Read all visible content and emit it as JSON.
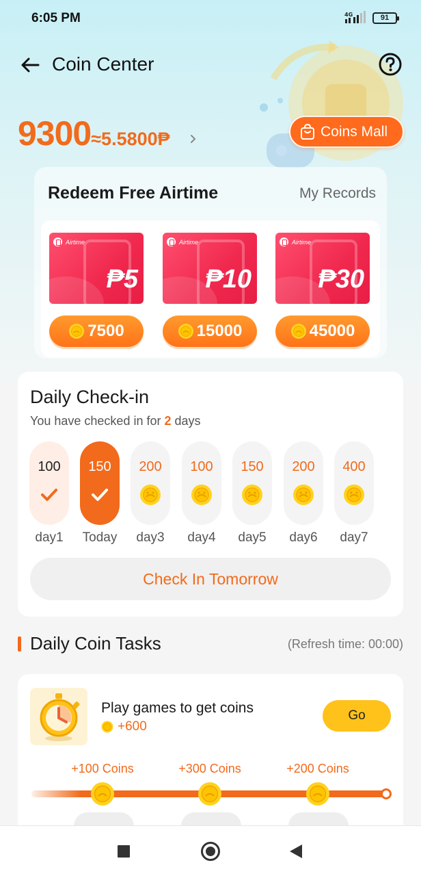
{
  "status_bar": {
    "time": "6:05 PM",
    "network": "4G",
    "battery": "91"
  },
  "header": {
    "title": "Coin Center"
  },
  "balance": {
    "coins": "9300",
    "equivalent": "≈5.5800₱"
  },
  "coins_mall": {
    "label": "Coins Mall"
  },
  "redeem": {
    "title": "Redeem Free Airtime",
    "records_label": "My Records",
    "items": [
      {
        "tag": "Airtime",
        "amount": "₱5",
        "price": "7500"
      },
      {
        "tag": "Airtime",
        "amount": "₱10",
        "price": "15000"
      },
      {
        "tag": "Airtime",
        "amount": "₱30",
        "price": "45000"
      }
    ]
  },
  "checkin": {
    "title": "Daily Check-in",
    "subtitle_prefix": "You have checked in for ",
    "days_count": "2",
    "subtitle_suffix": " days",
    "days": [
      {
        "value": "100",
        "label": "day1",
        "state": "done"
      },
      {
        "value": "150",
        "label": "Today",
        "state": "today"
      },
      {
        "value": "200",
        "label": "day3",
        "state": "pending"
      },
      {
        "value": "100",
        "label": "day4",
        "state": "pending"
      },
      {
        "value": "150",
        "label": "day5",
        "state": "pending"
      },
      {
        "value": "200",
        "label": "day6",
        "state": "pending"
      },
      {
        "value": "400",
        "label": "day7",
        "state": "pending"
      }
    ],
    "button_label": "Check In Tomorrow"
  },
  "tasks": {
    "title": "Daily Coin Tasks",
    "refresh": "(Refresh time: 00:00)",
    "task": {
      "name": "Play games to get coins",
      "reward": "+600",
      "button": "Go",
      "milestones": [
        {
          "label": "+100 Coins"
        },
        {
          "label": "+300 Coins"
        },
        {
          "label": "+200 Coins"
        }
      ]
    }
  },
  "colors": {
    "accent": "#f26a1b",
    "go_button": "#ffc21a",
    "airtime_card": "#f0284e"
  }
}
